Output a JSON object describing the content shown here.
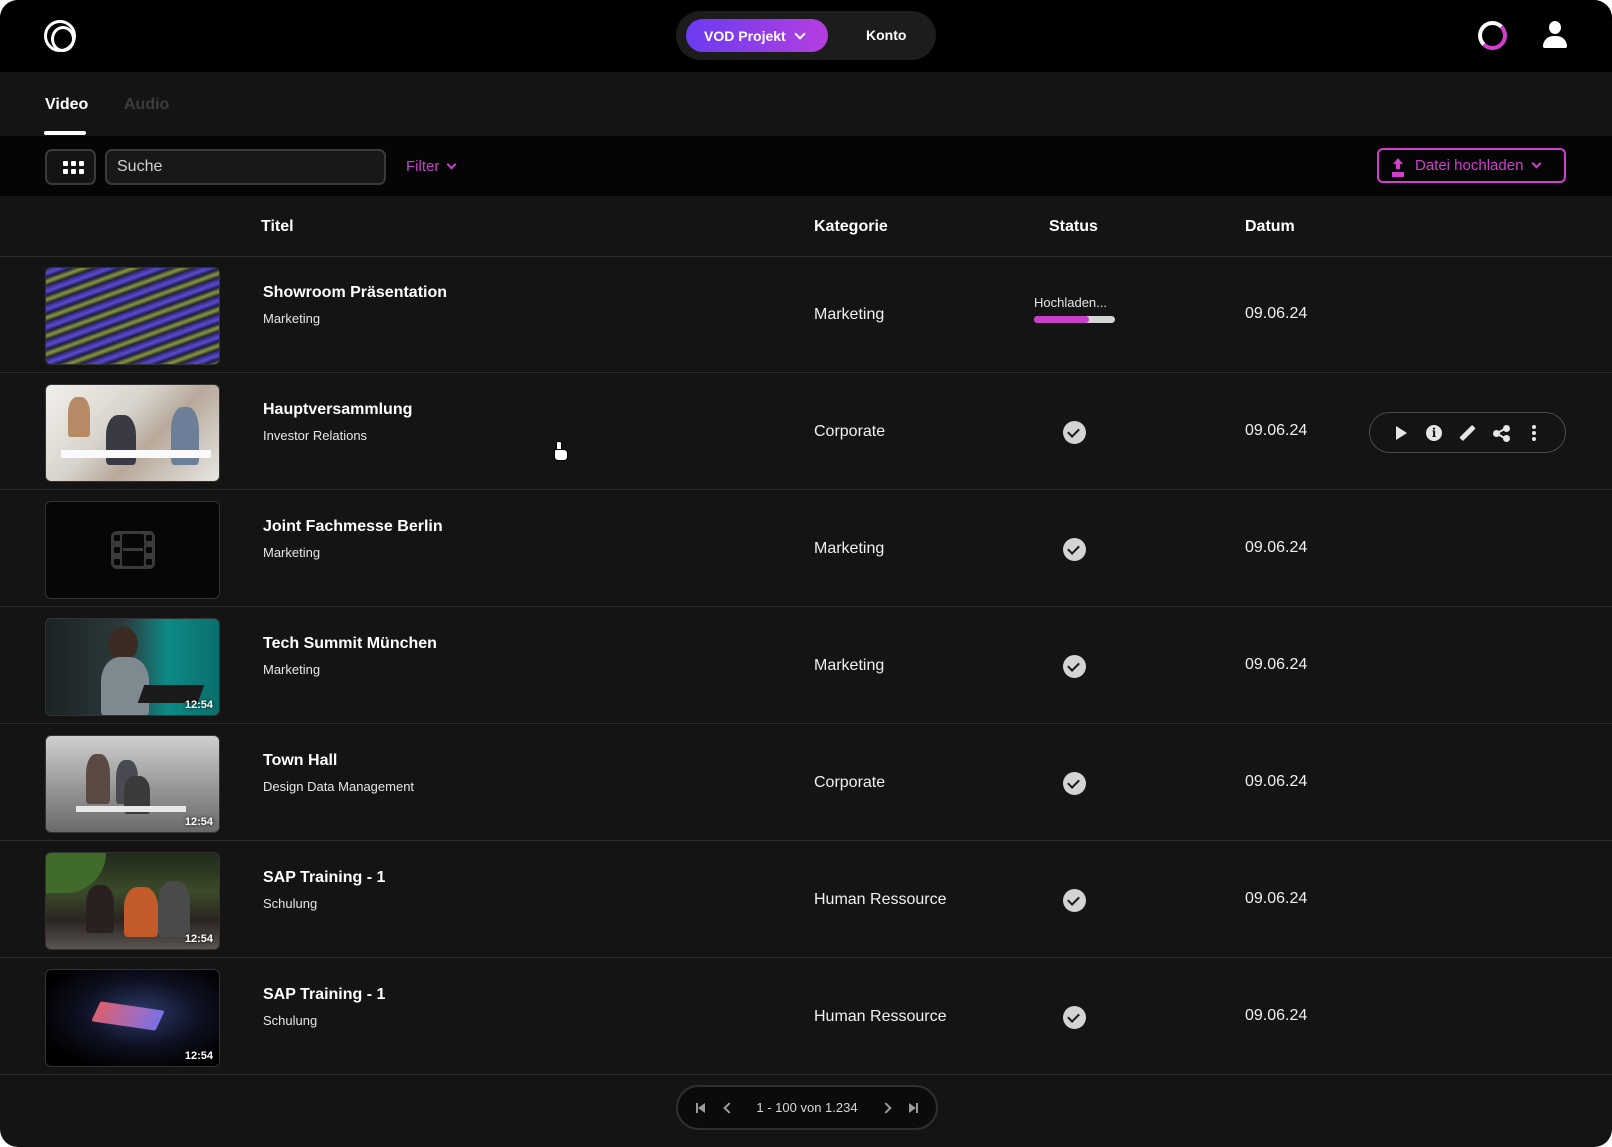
{
  "header": {
    "project_label": "VOD Projekt",
    "account_label": "Konto",
    "icons": [
      "logo-icon",
      "loading-ring-icon",
      "user-icon"
    ]
  },
  "tabs": [
    {
      "label": "Video",
      "active": true
    },
    {
      "label": "Audio",
      "active": false
    }
  ],
  "toolbar": {
    "search_placeholder": "Suche",
    "filter_label": "Filter",
    "upload_label": "Datei hochladen"
  },
  "colors": {
    "accent": "#d23fd0",
    "background": "#141414",
    "topbar": "#000000"
  },
  "table": {
    "columns": [
      "Titel",
      "Kategorie",
      "Status",
      "Datum"
    ],
    "rows": [
      {
        "title": "Showroom Präsentation",
        "subtitle": "Marketing",
        "category": "Marketing",
        "status": "Hochladen...",
        "progress": 0.68,
        "date": "09.06.24",
        "duration": ""
      },
      {
        "title": "Hauptversammlung",
        "subtitle": "Investor Relations",
        "category": "Corporate",
        "status": "done",
        "date": "09.06.24",
        "duration": ""
      },
      {
        "title": "Joint Fachmesse Berlin",
        "subtitle": "Marketing",
        "category": "Marketing",
        "status": "done",
        "date": "09.06.24",
        "duration": ""
      },
      {
        "title": "Tech Summit München",
        "subtitle": "Marketing",
        "category": "Marketing",
        "status": "done",
        "date": "09.06.24",
        "duration": "12:54"
      },
      {
        "title": "Town Hall",
        "subtitle": "Design Data Management",
        "category": "Corporate",
        "status": "done",
        "date": "09.06.24",
        "duration": "12:54"
      },
      {
        "title": "SAP Training - 1",
        "subtitle": "Schulung",
        "category": "Human Ressource",
        "status": "done",
        "date": "09.06.24",
        "duration": "12:54"
      },
      {
        "title": "SAP Training - 1",
        "subtitle": "Schulung",
        "category": "Human Ressource",
        "status": "done",
        "date": "09.06.24",
        "duration": "12:54"
      }
    ],
    "row_actions": [
      "play-icon",
      "info-icon",
      "edit-icon",
      "share-icon",
      "more-icon"
    ]
  },
  "pagination": {
    "label": "1 - 100 von 1.234"
  }
}
